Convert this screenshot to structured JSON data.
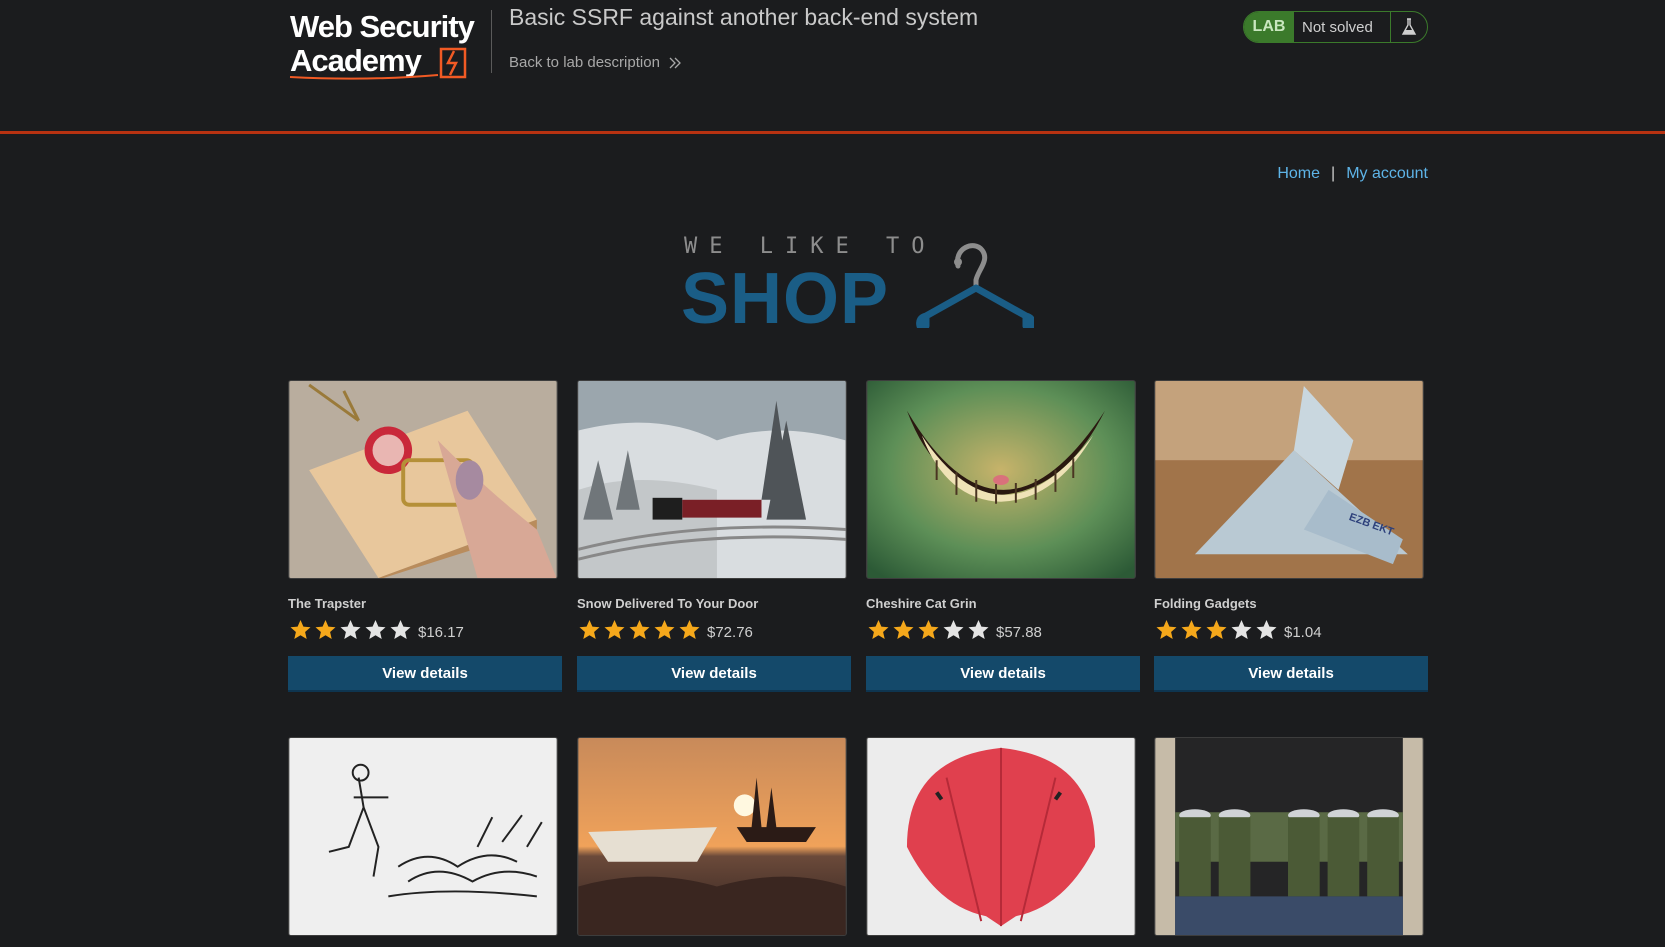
{
  "lab_header": {
    "logo_line1": "Web Security",
    "logo_line2": "Academy",
    "title": "Basic SSRF against another back-end system",
    "back_link": "Back to lab description",
    "lab_badge": "LAB",
    "status": "Not solved"
  },
  "nav": {
    "home": "Home",
    "separator": "|",
    "account": "My account"
  },
  "banner": {
    "small_text": "WE LIKE TO",
    "big_text": "SHOP"
  },
  "colors": {
    "background": "#1b1c1e",
    "accent_orange": "#b83211",
    "link_blue": "#5eb4e8",
    "button_blue": "#14496a",
    "star_gold": "#f5a81b",
    "lab_green": "#3b7a2b"
  },
  "products": [
    {
      "name": "The Trapster",
      "rating": 2,
      "price": "$16.17",
      "button": "View details",
      "image": "mousetrap"
    },
    {
      "name": "Snow Delivered To Your Door",
      "rating": 5,
      "price": "$72.76",
      "button": "View details",
      "image": "snow-train"
    },
    {
      "name": "Cheshire Cat Grin",
      "rating": 3,
      "price": "$57.88",
      "button": "View details",
      "image": "cat-grin"
    },
    {
      "name": "Folding Gadgets",
      "rating": 3,
      "price": "$1.04",
      "button": "View details",
      "image": "paper-bird"
    },
    {
      "name": "",
      "rating": null,
      "price": "",
      "button": "",
      "image": "sketch-drawing"
    },
    {
      "name": "",
      "rating": null,
      "price": "",
      "button": "",
      "image": "paper-boat-sunset"
    },
    {
      "name": "",
      "rating": null,
      "price": "",
      "button": "",
      "image": "red-umbrella"
    },
    {
      "name": "",
      "rating": null,
      "price": "",
      "button": "",
      "image": "beer-belt"
    }
  ]
}
